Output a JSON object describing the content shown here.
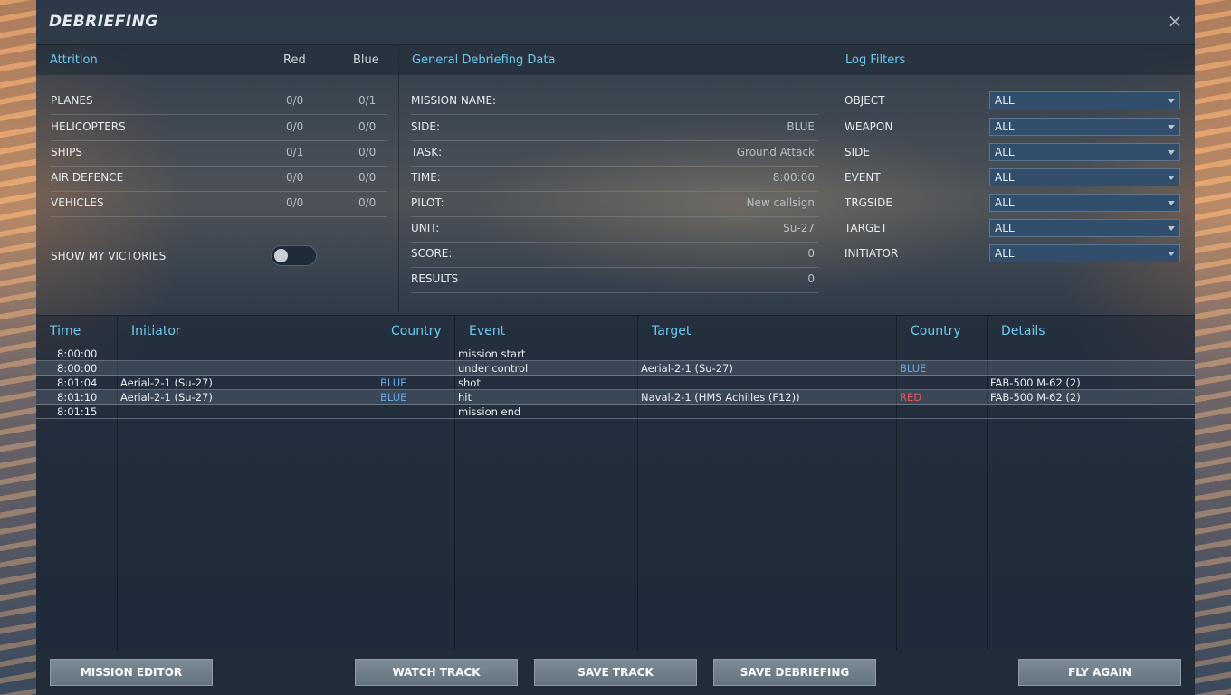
{
  "title": "DEBRIEFING",
  "close": "×",
  "attrition": {
    "header": "Attrition",
    "red_header": "Red",
    "blue_header": "Blue",
    "rows": [
      {
        "label": "PLANES",
        "red": "0/0",
        "blue": "0/1"
      },
      {
        "label": "HELICOPTERS",
        "red": "0/0",
        "blue": "0/0"
      },
      {
        "label": "SHIPS",
        "red": "0/1",
        "blue": "0/0"
      },
      {
        "label": "AIR DEFENCE",
        "red": "0/0",
        "blue": "0/0"
      },
      {
        "label": "VEHICLES",
        "red": "0/0",
        "blue": "0/0"
      }
    ],
    "show_victories_label": "SHOW MY VICTORIES",
    "show_victories_on": false
  },
  "general": {
    "header": "General Debriefing Data",
    "rows": [
      {
        "label": "MISSION NAME:",
        "value": ""
      },
      {
        "label": "SIDE:",
        "value": "BLUE"
      },
      {
        "label": "TASK:",
        "value": "Ground Attack"
      },
      {
        "label": "TIME:",
        "value": "8:00:00"
      },
      {
        "label": "PILOT:",
        "value": "New callsign"
      },
      {
        "label": "UNIT:",
        "value": "Su-27"
      },
      {
        "label": "SCORE:",
        "value": "0"
      },
      {
        "label": "RESULTS",
        "value": "0"
      }
    ]
  },
  "filters": {
    "header": "Log Filters",
    "rows": [
      {
        "label": "OBJECT",
        "value": "ALL"
      },
      {
        "label": "WEAPON",
        "value": "ALL"
      },
      {
        "label": "SIDE",
        "value": "ALL"
      },
      {
        "label": "EVENT",
        "value": "ALL"
      },
      {
        "label": "TRGSIDE",
        "value": "ALL"
      },
      {
        "label": "TARGET",
        "value": "ALL"
      },
      {
        "label": "INITIATOR",
        "value": "ALL"
      }
    ]
  },
  "log": {
    "columns": [
      "Time",
      "Initiator",
      "Country",
      "Event",
      "Target",
      "Country",
      "Details"
    ],
    "rows": [
      {
        "time": "8:00:00",
        "initiator": "",
        "country": "",
        "event": "mission start",
        "target": "",
        "tcountry": "",
        "details": ""
      },
      {
        "time": "8:00:00",
        "initiator": "",
        "country": "",
        "event": "under control",
        "target": "Aerial-2-1 (Su-27)",
        "tcountry": "BLUE",
        "details": ""
      },
      {
        "time": "8:01:04",
        "initiator": "Aerial-2-1 (Su-27)",
        "country": "BLUE",
        "event": "shot",
        "target": "",
        "tcountry": "",
        "details": "FAB-500 M-62 (2)"
      },
      {
        "time": "8:01:10",
        "initiator": "Aerial-2-1 (Su-27)",
        "country": "BLUE",
        "event": "hit",
        "target": "Naval-2-1 (HMS Achilles (F12))",
        "tcountry": "RED",
        "details": "FAB-500 M-62 (2)"
      },
      {
        "time": "8:01:15",
        "initiator": "",
        "country": "",
        "event": "mission end",
        "target": "",
        "tcountry": "",
        "details": ""
      }
    ]
  },
  "buttons": {
    "mission_editor": "MISSION EDITOR",
    "watch_track": "WATCH TRACK",
    "save_track": "SAVE TRACK",
    "save_debriefing": "SAVE DEBRIEFING",
    "fly_again": "FLY AGAIN"
  },
  "colors": {
    "accent": "#6dc8ee",
    "blue_side": "#64a8e6",
    "red_side": "#e4575b",
    "dropdown": "#324e6d"
  }
}
